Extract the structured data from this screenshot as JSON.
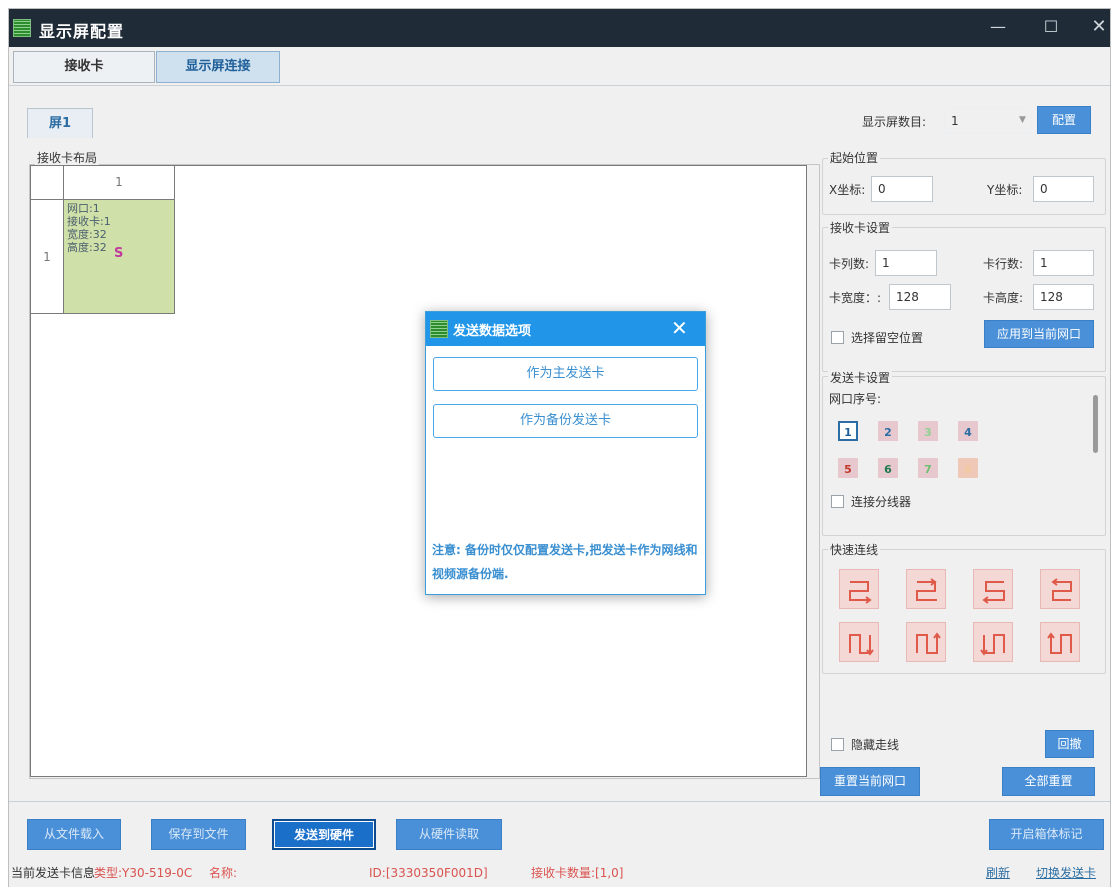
{
  "window": {
    "title": "显示屏配置",
    "min": "—",
    "max": "☐",
    "close": "✕"
  },
  "tabs": {
    "receiver": "接收卡",
    "connection": "显示屏连接"
  },
  "screen_tab": "屏1",
  "layout": {
    "title": "接收卡布局",
    "col_header": "1",
    "row_header": "1",
    "cell": {
      "port": "网口:1",
      "card": "接收卡:1",
      "width": "宽度:32",
      "height": "高度:32",
      "mark": "S"
    }
  },
  "right": {
    "screen_count_label": "显示屏数目:",
    "screen_count_value": "1",
    "config_btn": "配置",
    "start": {
      "title": "起始位置",
      "x_label": "X坐标:",
      "x_value": "0",
      "y_label": "Y坐标:",
      "y_value": "0"
    },
    "recv": {
      "title": "接收卡设置",
      "cols_label": "卡列数:",
      "cols_value": "1",
      "rows_label": "卡行数:",
      "rows_value": "1",
      "width_label": "卡宽度：:",
      "width_value": "128",
      "height_label": "卡高度:",
      "height_value": "128",
      "empty_label": "选择留空位置",
      "apply_btn": "应用到当前网口"
    },
    "send": {
      "title": "发送卡设置",
      "port_label": "网口序号:",
      "ports": [
        {
          "n": "1",
          "fg": "#1f5f99",
          "bg": "#ffffff",
          "border": "#2c6ea3"
        },
        {
          "n": "2",
          "fg": "#2c6ea3",
          "bg": "#e8c8cf",
          "border": "#e8c8cf"
        },
        {
          "n": "3",
          "fg": "#8fd18f",
          "bg": "#e8c8cf",
          "border": "#e8c8cf"
        },
        {
          "n": "4",
          "fg": "#2c6ea3",
          "bg": "#e8c8cf",
          "border": "#e8c8cf"
        },
        {
          "n": "5",
          "fg": "#c0392b",
          "bg": "#e8c8cf",
          "border": "#e8c8cf"
        },
        {
          "n": "6",
          "fg": "#1e7a4c",
          "bg": "#e8c8cf",
          "border": "#e8c8cf"
        },
        {
          "n": "7",
          "fg": "#6fbf6f",
          "bg": "#e8c8cf",
          "border": "#e8c8cf"
        },
        {
          "n": "8",
          "fg": "#f0c8a0",
          "bg": "#f0c8b8",
          "border": "#f0c8b8"
        }
      ],
      "splitter_label": "连接分线器"
    },
    "quick": {
      "title": "快速连线"
    },
    "hide_lines_label": "隐藏走线",
    "undo_btn": "回撤",
    "reset_port_btn": "重置当前网口",
    "reset_all_btn": "全部重置"
  },
  "bottom": {
    "load_file": "从文件载入",
    "save_file": "保存到文件",
    "send_hw": "发送到硬件",
    "read_hw": "从硬件读取",
    "box_mark": "开启箱体标记"
  },
  "status": {
    "prefix": "当前发送卡信息",
    "type": "类型:Y30-519-0C",
    "name": "名称:",
    "id": "ID:[3330350F001D]",
    "recv_count": "接收卡数量:[1,0]",
    "refresh": "刷新",
    "switch": "切换发送卡"
  },
  "dialog": {
    "title": "发送数据选项",
    "close": "✕",
    "main_btn": "作为主发送卡",
    "backup_btn": "作为备份发送卡",
    "note": "注意: 备份时仅仅配置发送卡,把发送卡作为网线和视频源备份端."
  }
}
